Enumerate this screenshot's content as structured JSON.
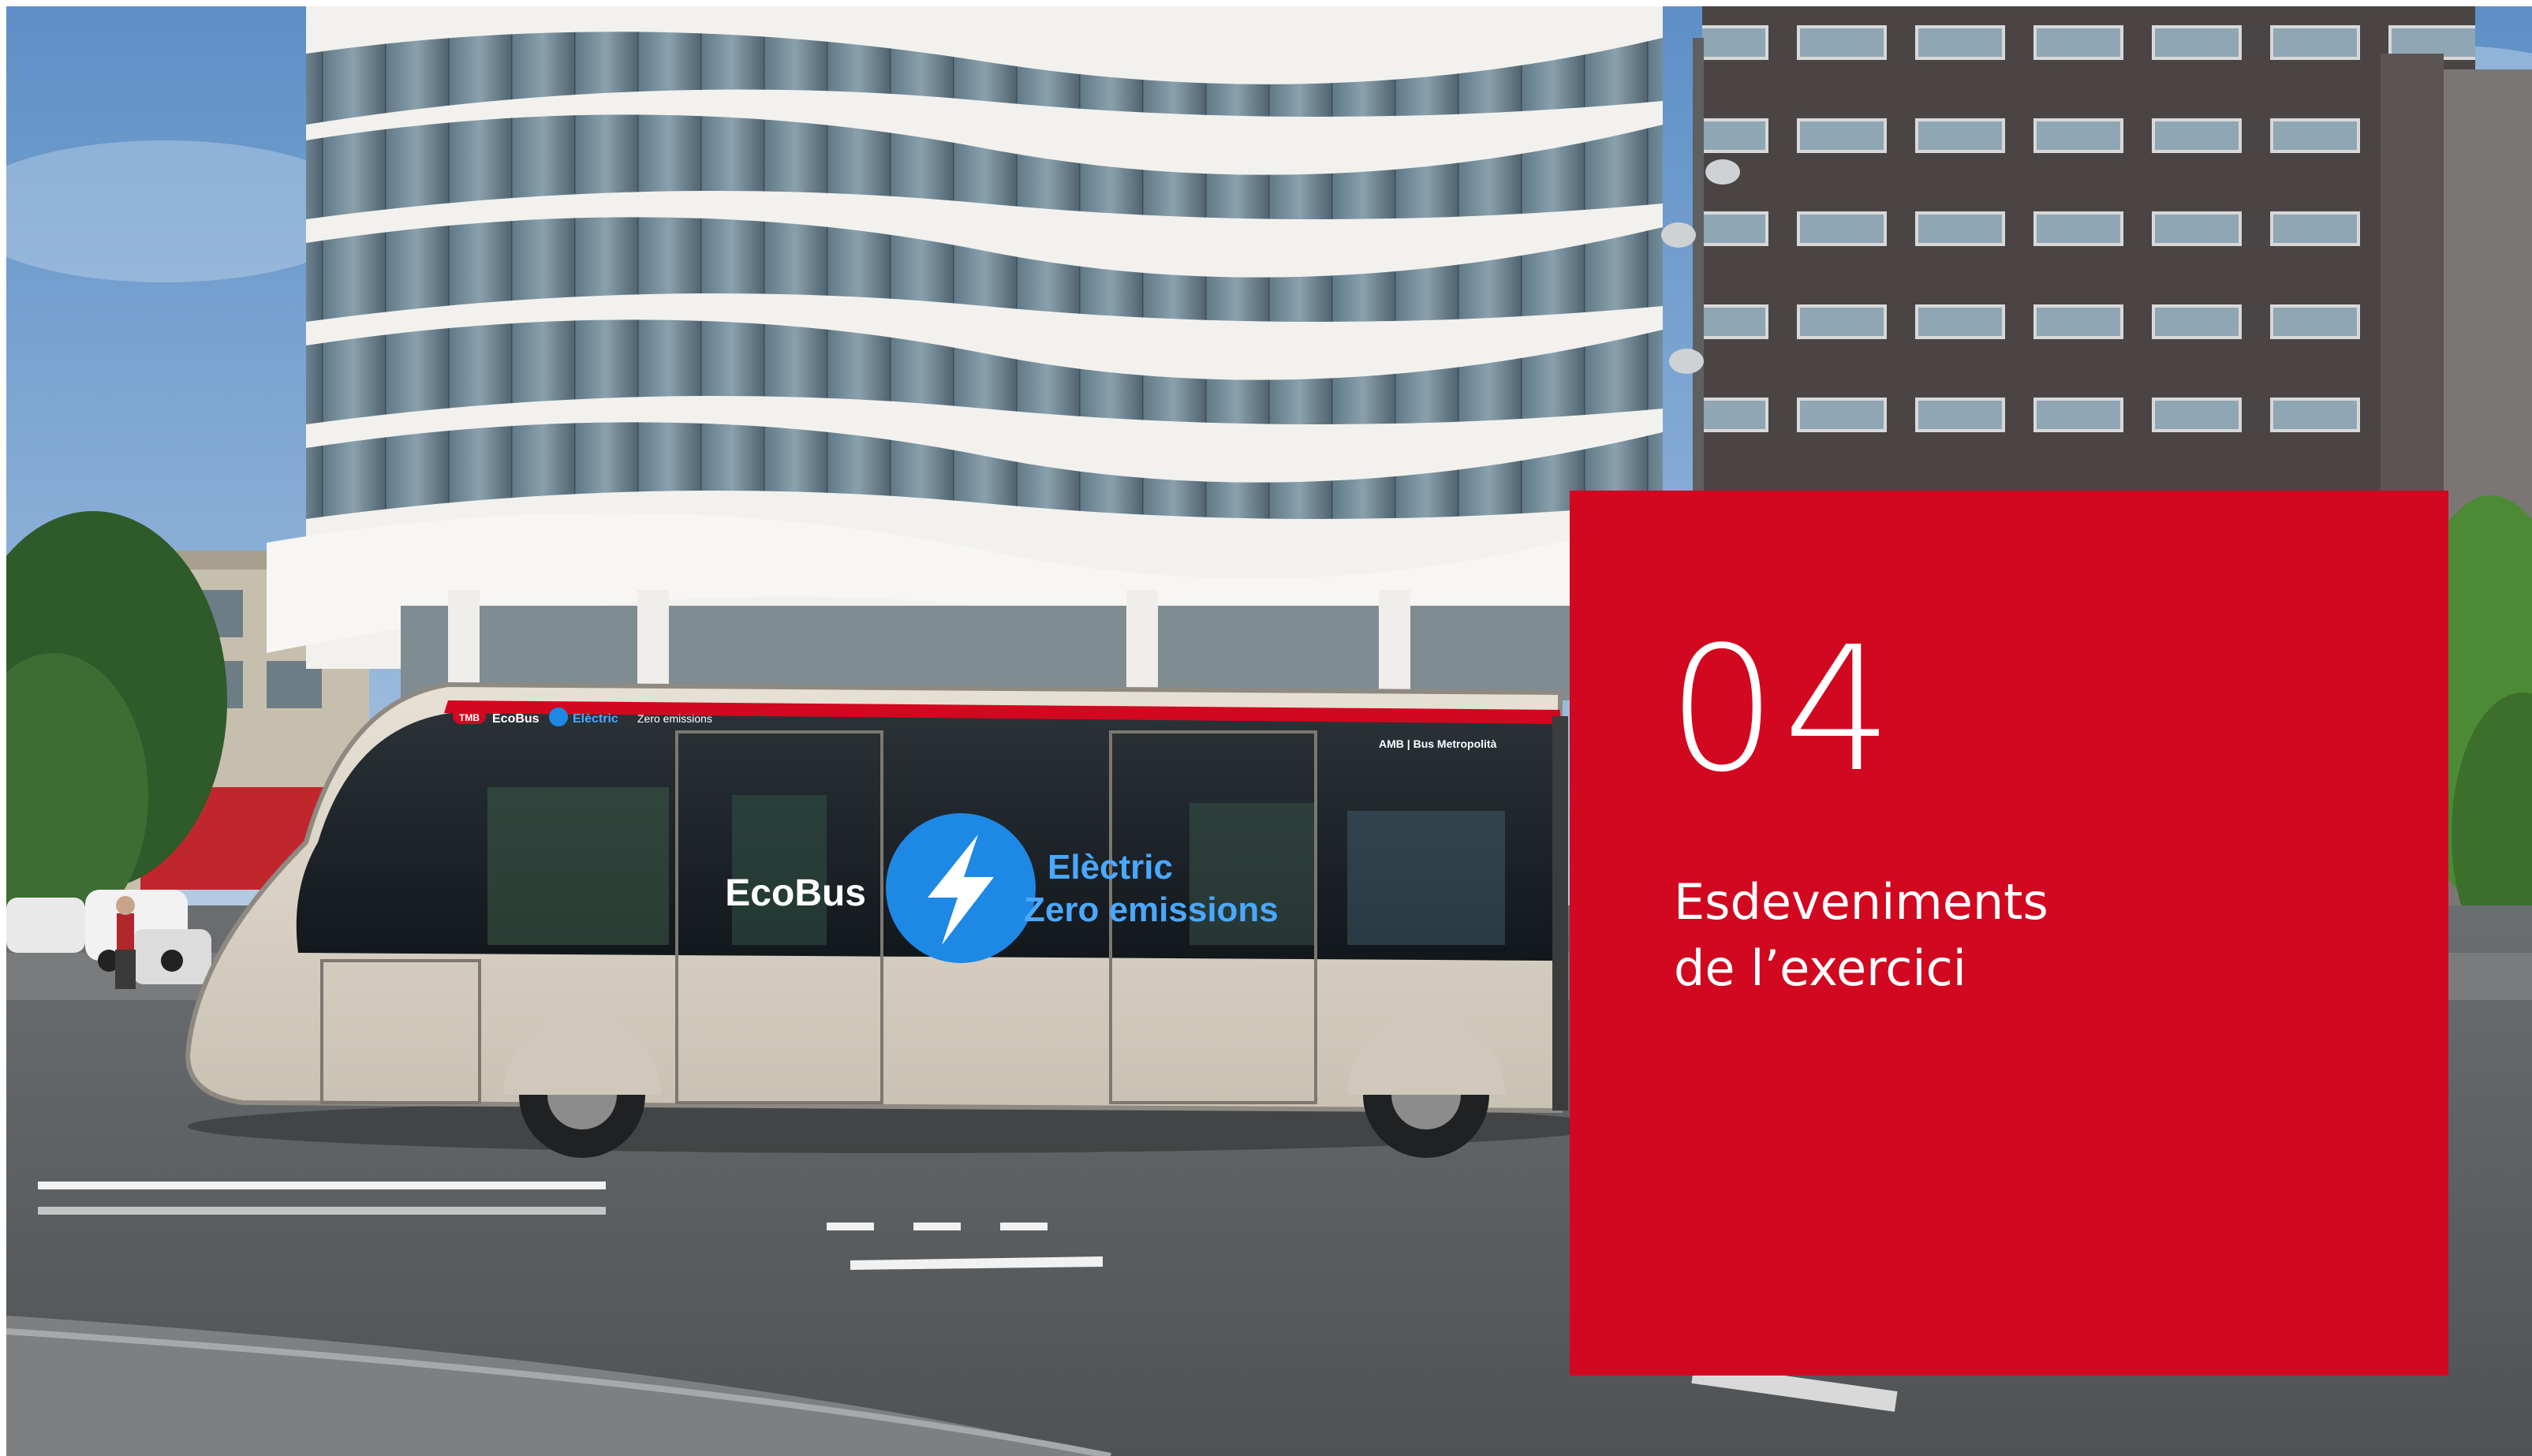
{
  "section": {
    "number": "04",
    "title_lines": [
      "Esdeveniments",
      "de l’exercici"
    ]
  },
  "bus": {
    "brand": "EcoBus",
    "line1": "Elèctric",
    "line2": "Zero emissions",
    "top_strip_brand": "EcoBus",
    "top_strip_electric": "Elèctric",
    "top_strip_zero": "Zero emissions",
    "operator": "AMB | Bus Metropolità",
    "operator_badge": "TMB"
  },
  "colors": {
    "accent_red": "#d1081f",
    "sky": "#6f9fd0",
    "bus_body": "#dcd5c8",
    "bus_window": "#1c2228",
    "bolt_blue": "#1e88e5",
    "road": "#5d6063"
  }
}
